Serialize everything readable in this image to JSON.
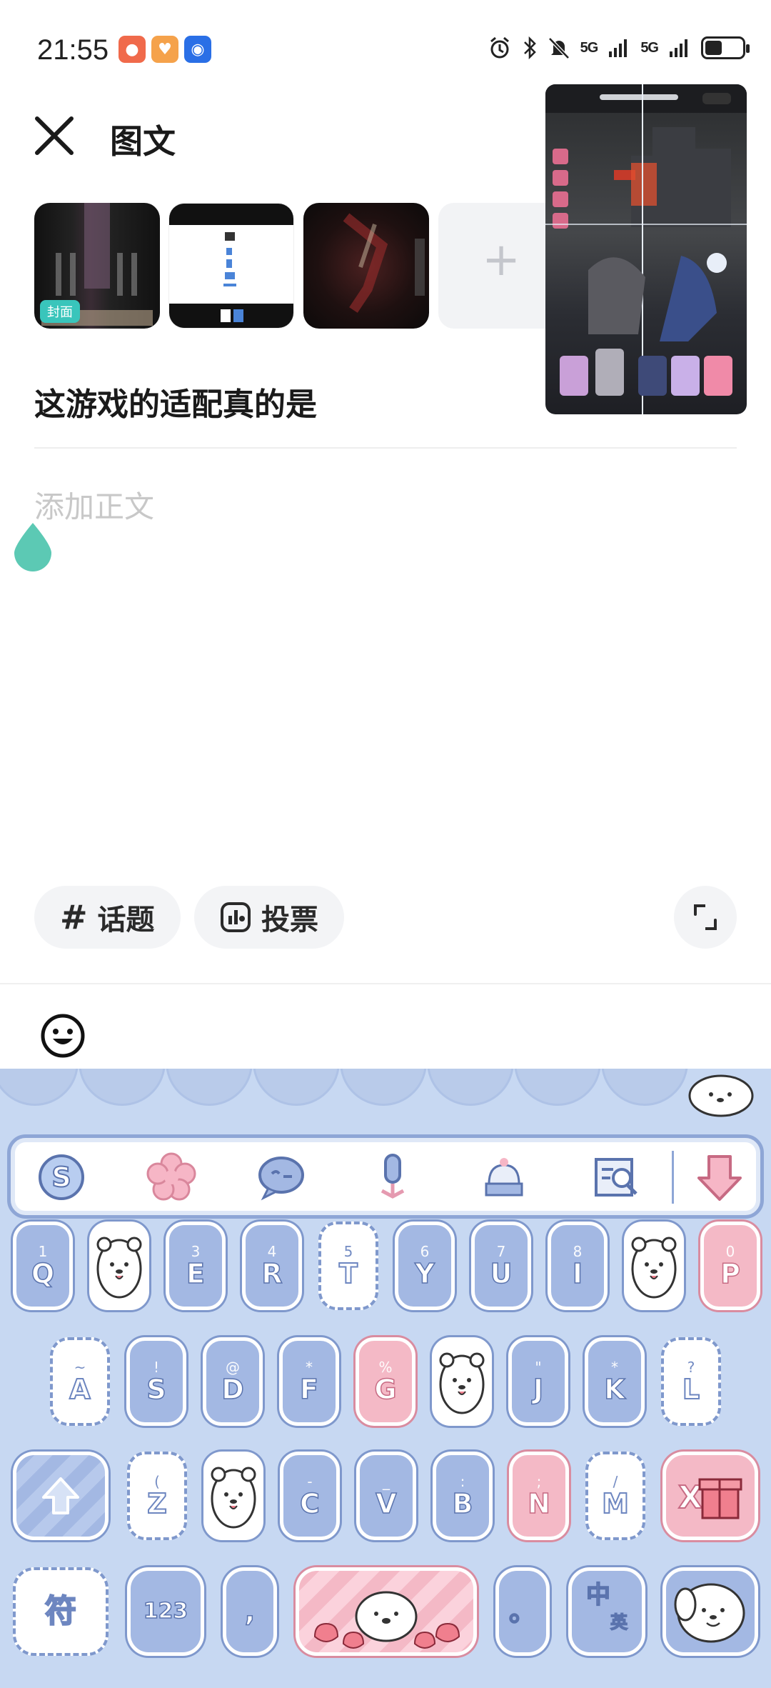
{
  "status_bar": {
    "time": "21:55",
    "network_1": "5G",
    "network_2": "5G",
    "battery_level": 0.45
  },
  "header": {
    "title": "图文"
  },
  "media": {
    "cover_tag": "封面",
    "add_icon": "+"
  },
  "post": {
    "title": "这游戏的适配真的是",
    "body_placeholder": "添加正文"
  },
  "actions": {
    "topic_label": "话题",
    "vote_label": "投票"
  },
  "keyboard": {
    "row1": [
      {
        "sup": "1",
        "main": "Q",
        "style": "blue"
      },
      {
        "sup": "",
        "main": "",
        "style": "bear"
      },
      {
        "sup": "3",
        "main": "E",
        "style": "blue"
      },
      {
        "sup": "4",
        "main": "R",
        "style": "blue"
      },
      {
        "sup": "5",
        "main": "T",
        "style": "dash"
      },
      {
        "sup": "6",
        "main": "Y",
        "style": "blue"
      },
      {
        "sup": "7",
        "main": "U",
        "style": "blue"
      },
      {
        "sup": "8",
        "main": "I",
        "style": "blue"
      },
      {
        "sup": "",
        "main": "",
        "style": "bear"
      },
      {
        "sup": "0",
        "main": "P",
        "style": "pink"
      }
    ],
    "row2": [
      {
        "sup": "~",
        "main": "A",
        "style": "dash"
      },
      {
        "sup": "!",
        "main": "S",
        "style": "blue"
      },
      {
        "sup": "@",
        "main": "D",
        "style": "blue"
      },
      {
        "sup": "*",
        "main": "F",
        "style": "blue"
      },
      {
        "sup": "%",
        "main": "G",
        "style": "pink"
      },
      {
        "sup": "",
        "main": "",
        "style": "bear"
      },
      {
        "sup": "\"",
        "main": "J",
        "style": "blue"
      },
      {
        "sup": "*",
        "main": "K",
        "style": "blue"
      },
      {
        "sup": "?",
        "main": "L",
        "style": "dash"
      }
    ],
    "row3": [
      {
        "sup": "(",
        "main": "Z",
        "style": "dash"
      },
      {
        "sup": "",
        "main": "",
        "style": "bear"
      },
      {
        "sup": "-",
        "main": "C",
        "style": "blue"
      },
      {
        "sup": "_",
        "main": "V",
        "style": "blue"
      },
      {
        "sup": ":",
        "main": "B",
        "style": "blue"
      },
      {
        "sup": ";",
        "main": "N",
        "style": "pink"
      },
      {
        "sup": "/",
        "main": "M",
        "style": "dash"
      }
    ],
    "symbol_key": "符",
    "num_key": "123",
    "comma_key": ",",
    "period_key": "。",
    "lang_key_zh": "中",
    "lang_key_en": "英"
  },
  "colors": {
    "accent_teal": "#39c5bb",
    "keyboard_bg": "#c7d8f2",
    "key_blue": "#a3b8e3",
    "key_pink": "#f4b9c6"
  },
  "icons": [
    "close-icon",
    "alarm-icon",
    "bluetooth-icon",
    "mute-icon",
    "signal-icon",
    "battery-icon",
    "hashtag-icon",
    "vote-icon",
    "expand-icon",
    "emoji-icon",
    "sogou-icon",
    "flower-icon",
    "chat-icon",
    "microphone-icon",
    "cake-icon",
    "image-search-icon",
    "hide-keyboard-icon",
    "shift-icon",
    "delete-icon"
  ]
}
